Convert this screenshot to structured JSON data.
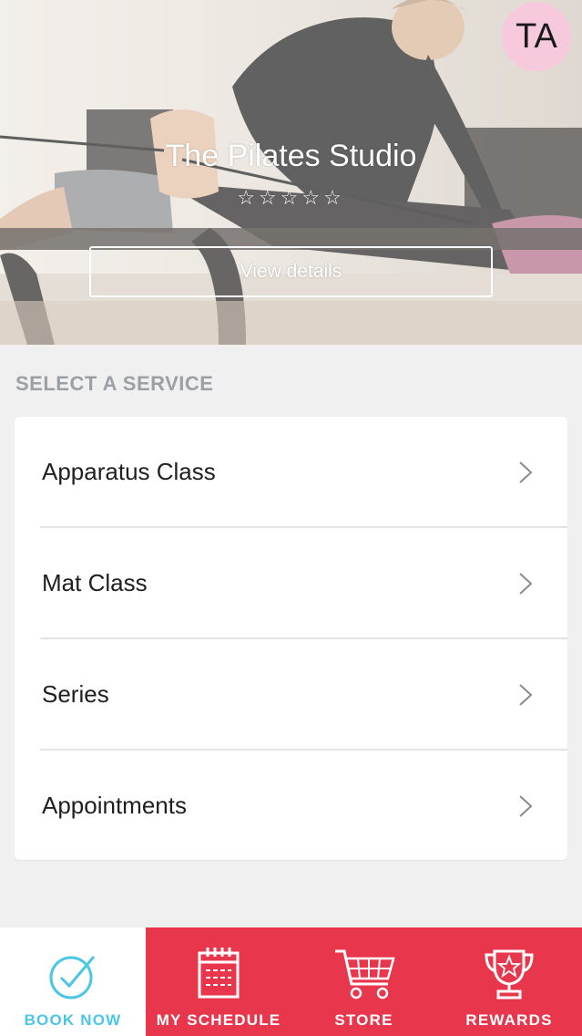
{
  "hero": {
    "studio_name": "The Pilates Studio",
    "rating_stars": "☆☆☆☆☆",
    "view_details_label": "View details"
  },
  "avatar": {
    "initials": "TA"
  },
  "services": {
    "section_title": "SELECT A SERVICE",
    "items": [
      {
        "label": "Apparatus Class"
      },
      {
        "label": "Mat Class"
      },
      {
        "label": "Series"
      },
      {
        "label": "Appointments"
      }
    ]
  },
  "tabbar": {
    "tabs": [
      {
        "label": "BOOK NOW",
        "icon": "checkmark-circle-icon",
        "active": true
      },
      {
        "label": "MY SCHEDULE",
        "icon": "calendar-icon",
        "active": false
      },
      {
        "label": "STORE",
        "icon": "cart-icon",
        "active": false
      },
      {
        "label": "REWARDS",
        "icon": "trophy-icon",
        "active": false
      }
    ]
  },
  "colors": {
    "accent_blue": "#4ac6e6",
    "tab_red": "#e8374c",
    "avatar_pink": "#f7c9dd",
    "section_gray": "#9aa0a3"
  }
}
